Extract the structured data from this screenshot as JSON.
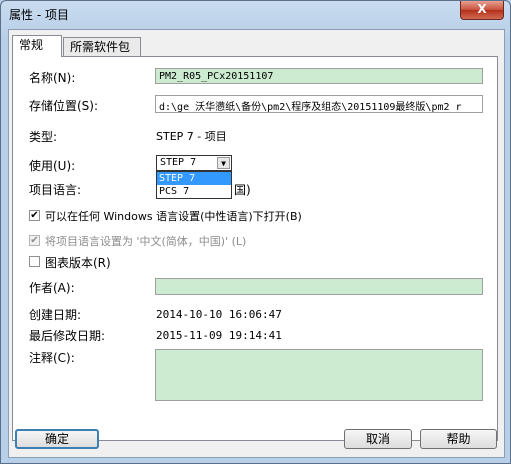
{
  "window": {
    "title": "属性 - 项目",
    "close_glyph": "X"
  },
  "tabs": [
    {
      "label": "常规"
    },
    {
      "label": "所需软件包"
    }
  ],
  "general": {
    "name_label": "名称(N):",
    "name_value": "PM2_R05_PCx20151107",
    "location_label": "存储位置(S):",
    "location_value": "d:\\ge 沃华懑纸\\备份\\pm2\\程序及组态\\20151109最终版\\pm2_r",
    "type_label": "类型:",
    "type_value": "STEP 7 - 项目",
    "use_label": "使用(U):",
    "use_selected": "STEP 7",
    "use_options": [
      "STEP 7",
      "PCS 7"
    ],
    "lang_label": "项目语言:",
    "lang_value_tail": "国)",
    "open_any_lang_label": "可以在任何 Windows 语言设置(中性语言)下打开(B)",
    "open_any_lang_checked": true,
    "set_lang_label": "将项目语言设置为 '中文(简体，中国)' (L)",
    "set_lang_checked": true,
    "chart_version_label": "图表版本(R)",
    "chart_version_checked": false,
    "author_label": "作者(A):",
    "author_value": "",
    "created_label": "创建日期:",
    "created_value": "2014-10-10 16:06:47",
    "modified_label": "最后修改日期:",
    "modified_value": "2015-11-09 19:14:41",
    "comment_label": "注释(C):",
    "comment_value": ""
  },
  "buttons": {
    "ok": "确定",
    "cancel": "取消",
    "help": "帮助"
  }
}
